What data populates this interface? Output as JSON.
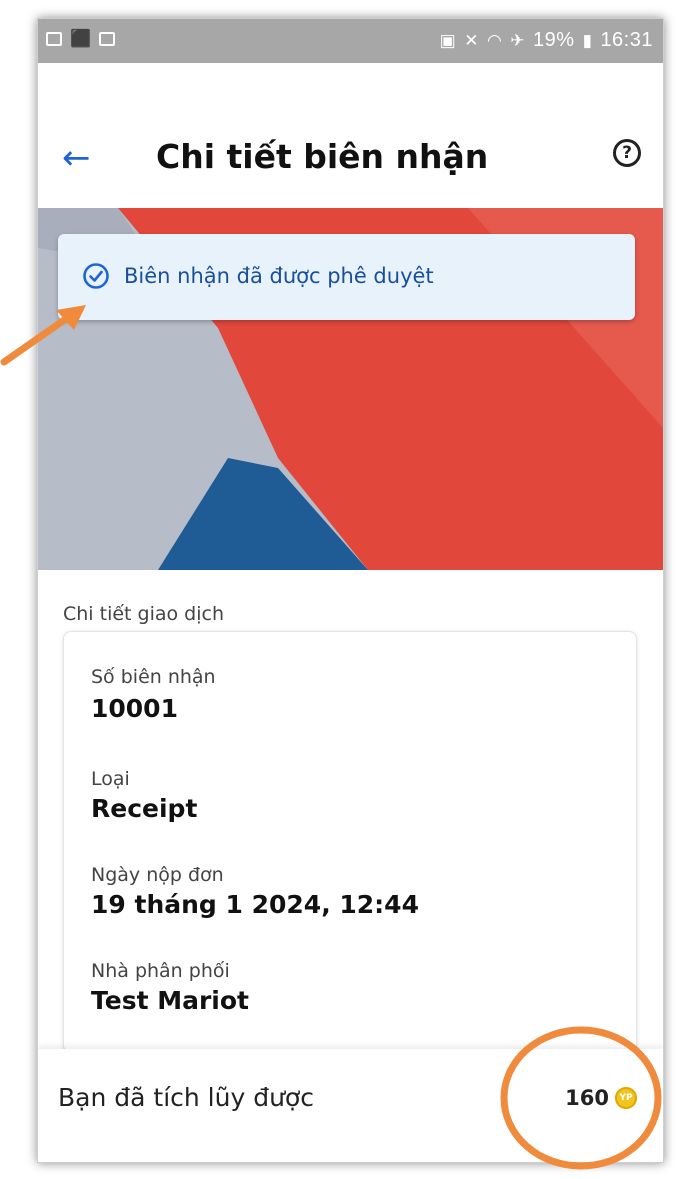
{
  "status_bar": {
    "battery": "19%",
    "time": "16:31"
  },
  "header": {
    "title": "Chi tiết biên nhận"
  },
  "banner": {
    "message": "Biên nhận đã được phê duyệt"
  },
  "details": {
    "section_title": "Chi tiết giao dịch",
    "fields": [
      {
        "label": "Số biên nhận",
        "value": "10001"
      },
      {
        "label": "Loại",
        "value": "Receipt"
      },
      {
        "label": "Ngày nộp đơn",
        "value": "19 tháng 1 2024, 12:44"
      },
      {
        "label": "Nhà phân phối",
        "value": "Test Mariot"
      }
    ]
  },
  "footer": {
    "label": "Bạn đã tích lũy được",
    "points": "160",
    "coin_text": "YP"
  },
  "colors": {
    "accent": "#1d64d6",
    "annotation": "#f08a3c",
    "hero_red": "#e2473c"
  }
}
